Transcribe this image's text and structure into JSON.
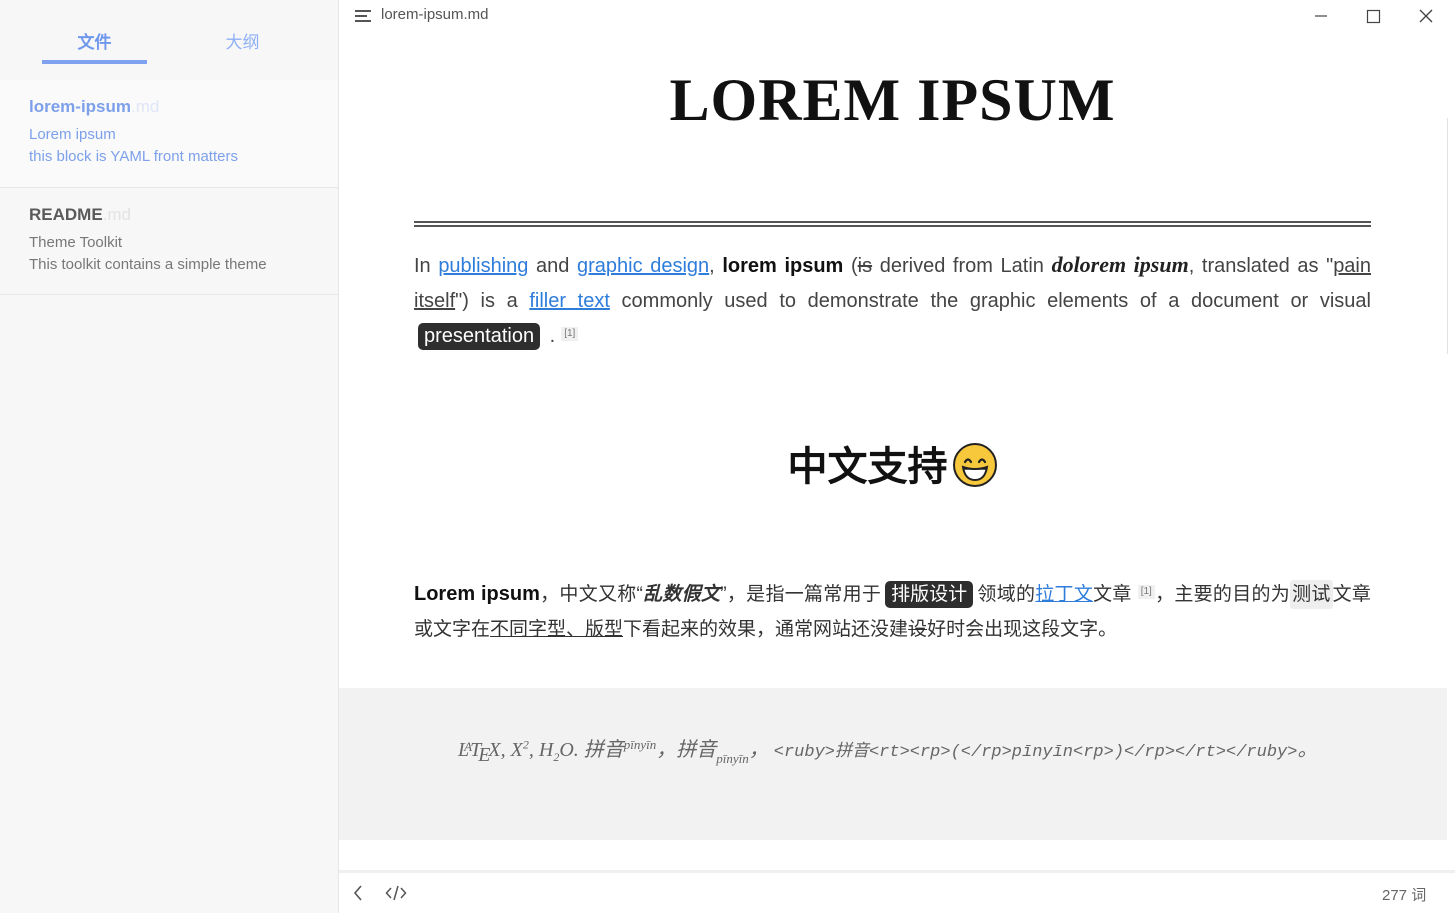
{
  "sidebar": {
    "tabs": [
      {
        "label": "文件"
      },
      {
        "label": "大纲"
      }
    ],
    "files": [
      {
        "name": "lorem-ipsum",
        "ext": ".md",
        "line1": "Lorem ipsum",
        "line2": "this block is YAML front matters"
      },
      {
        "name": "README",
        "ext": ".md",
        "line1": "Theme Toolkit",
        "line2": "This toolkit contains a simple theme"
      }
    ]
  },
  "titlebar": {
    "filename": "lorem-ipsum.md"
  },
  "doc": {
    "h1": "LOREM IPSUM",
    "p1": {
      "t1": "In ",
      "link1": "publishing",
      "t2": " and ",
      "link2": "graphic design",
      "t3": ", ",
      "bold": "lorem ipsum",
      "t4": " (",
      "strike": "is",
      "t5": " derived from Latin ",
      "latin": "dolorem ipsum",
      "t6": ", translated as \"",
      "underline": "pain itself",
      "t7": "\") is a ",
      "link3": "filler text",
      "t8": " commonly used to demonstrate the graphic elements of a document or visual ",
      "kbd": "presentation",
      "t9": " .",
      "fn": "[1]"
    },
    "h2": "中文支持",
    "p2": {
      "bold": "Lorem ipsum",
      "t1": "，中文又称“",
      "ital": "乱数假文",
      "t2": "”，是指一篇常用于",
      "kbd": "排版设计",
      "t3": "领域的",
      "link": "拉丁文",
      "t4": "文章",
      "fn": "[1]",
      "t5": "，主要的目的为",
      "code": "测试",
      "t6": "文章或文字在",
      "underline": "不同字型、版型",
      "t7": "下看起来的效果，通常网站还没建",
      "strike": "设",
      "t8": "好时会出现这段文字。"
    },
    "quote": {
      "latex_la": "L",
      "latex_a": "A",
      "latex_te": "T",
      "latex_e": "E",
      "latex_x": "X",
      "q1": ", X",
      "sup2": "2",
      "q2": ", H",
      "sub2": "2",
      "q3": "O. ",
      "ruby1": "拼音",
      "ruby1_rt": "pīnyīn",
      "q4": "，",
      "ruby2": "拼音",
      "ruby2_rb": "pīnyīn",
      "q5": "，",
      "code": "<ruby>拼音<rt><rp>(</rp>pīnyīn<rp>)</rp></rt></ruby>",
      "q6": "。"
    }
  },
  "statusbar": {
    "word_count": "277 词"
  },
  "colors": {
    "accent": "#7ea2f0",
    "link": "#2f7ddb",
    "sidebar_bg": "#f7f7f7"
  }
}
